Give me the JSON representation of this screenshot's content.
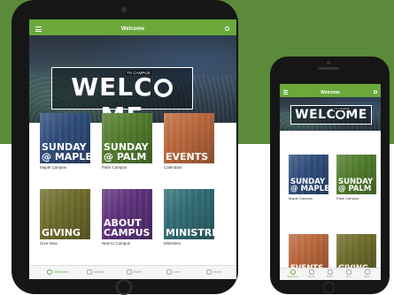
{
  "app": {
    "title": "Welcome",
    "banner_text": "WELC",
    "banner_text_end": "ME",
    "banner_subtext": "TO CAMPUS"
  },
  "tiles": [
    {
      "label": "SUNDAY\n@ MAPLE",
      "caption": "Maple Campus",
      "color": "#2d4a78",
      "image": "church-building"
    },
    {
      "label": "SUNDAY\n@ PALM",
      "caption": "Palm Campus",
      "color": "#4f7a2a",
      "image": "church-building"
    },
    {
      "label": "EVENTS",
      "caption": "Calendars",
      "color": "#b8653a",
      "image": "calendar"
    },
    {
      "label": "GIVING",
      "caption": "Give Now",
      "color": "#6d6a2a",
      "image": "hands"
    },
    {
      "label": "ABOUT\nCAMPUS",
      "caption": "New to Campus",
      "color": "#5b2f7a",
      "image": "people"
    },
    {
      "label": "MINISTRIES",
      "caption": "Ministries",
      "color": "#2f6a72",
      "image": "crowd"
    }
  ],
  "tabs": [
    {
      "label": "Welcome",
      "icon": "home-icon",
      "active": true
    },
    {
      "label": "Media",
      "icon": "media-icon"
    },
    {
      "label": "Bible",
      "icon": "bible-icon"
    },
    {
      "label": "Live",
      "icon": "live-icon"
    },
    {
      "label": "More",
      "icon": "more-icon"
    }
  ],
  "colors": {
    "accent": "#6aa83c",
    "background_band": "#5a8a3a"
  }
}
